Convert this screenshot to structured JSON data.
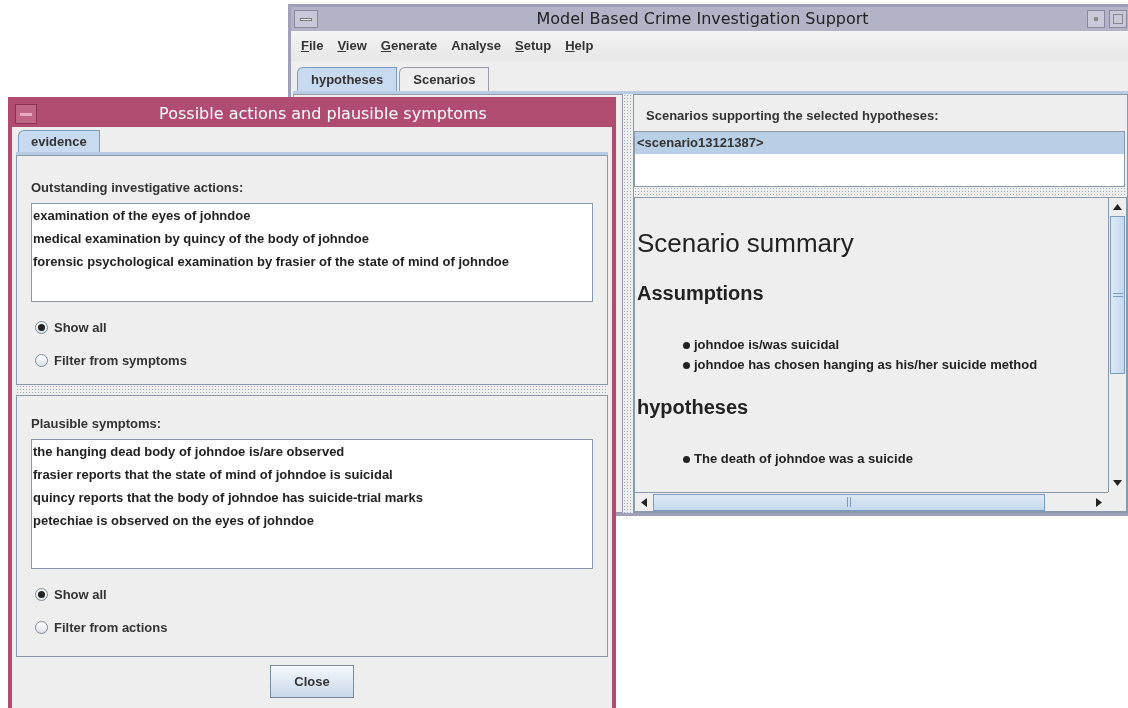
{
  "main_window": {
    "title": "Model Based Crime Investigation Support",
    "menu": [
      {
        "label": "File",
        "underlined": true
      },
      {
        "label": "View",
        "underlined": true
      },
      {
        "label": "Generate",
        "underlined": true
      },
      {
        "label": "Analyse",
        "underlined": false
      },
      {
        "label": "Setup",
        "underlined": true
      },
      {
        "label": "Help",
        "underlined": true
      }
    ],
    "tabs": [
      {
        "label": "hypotheses",
        "selected": true
      },
      {
        "label": "Scenarios",
        "selected": false
      }
    ],
    "scenarios_label": "Scenarios supporting the selected hypotheses:",
    "scenarios": [
      {
        "text": "<scenario13121387>",
        "selected": true
      }
    ],
    "summary": {
      "title": "Scenario summary",
      "sections": [
        {
          "heading": "Assumptions",
          "items": [
            "johndoe is/was suicidal",
            "johndoe has chosen hanging as his/her suicide method"
          ]
        },
        {
          "heading": "hypotheses",
          "items": [
            "The death of johndoe was a suicide"
          ]
        }
      ]
    }
  },
  "dialog": {
    "title": "Possible actions and plausible symptoms",
    "tabs": [
      {
        "label": "evidence",
        "selected": true
      }
    ],
    "panels": [
      {
        "label": "Outstanding investigative actions:",
        "items": [
          "examination of the eyes of johndoe",
          "medical examination by quincy of the body of johndoe",
          "forensic psychological examination by frasier of the state of mind of johndoe"
        ],
        "options": [
          {
            "label": "Show all",
            "selected": true
          },
          {
            "label": "Filter from symptoms",
            "selected": false
          }
        ]
      },
      {
        "label": "Plausible symptoms:",
        "items": [
          "the hanging dead body of johndoe is/are observed",
          "frasier reports that the state of mind of johndoe is suicidal",
          "quincy reports that the body of johndoe has suicide-trial marks",
          "petechiae is observed on the eyes of johndoe"
        ],
        "options": [
          {
            "label": "Show all",
            "selected": true
          },
          {
            "label": "Filter from actions",
            "selected": false
          }
        ]
      }
    ],
    "button": "Close"
  }
}
